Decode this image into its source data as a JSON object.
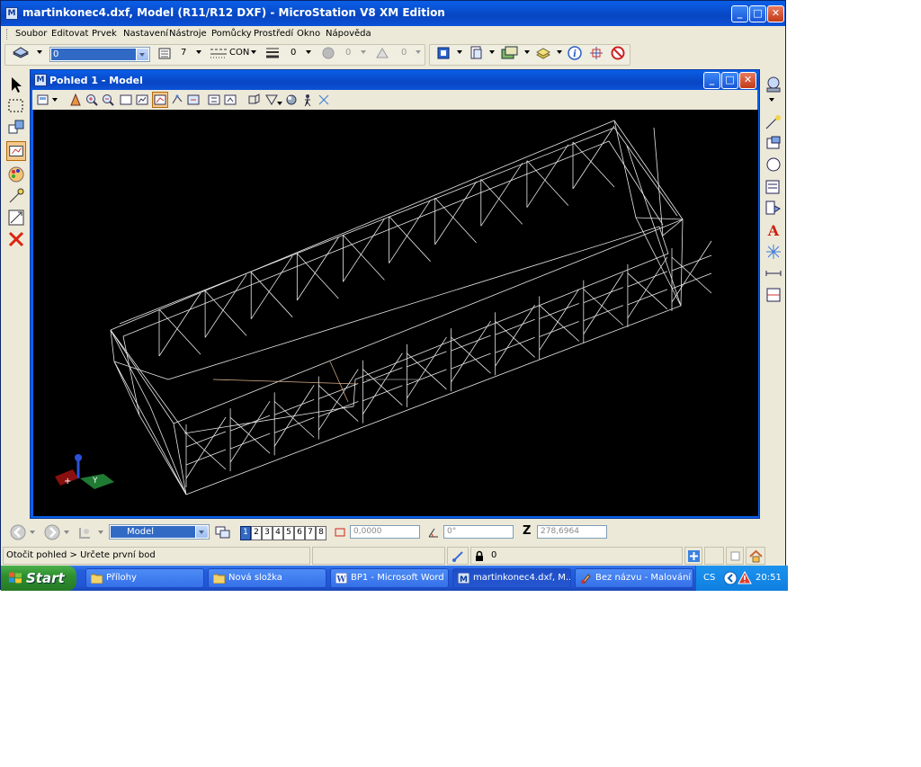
{
  "window": {
    "title": "martinkonec4.dxf, Model (R11/R12 DXF) - MicroStation V8 XM Edition",
    "app_icon": "microstation-icon"
  },
  "menu": [
    "Soubor",
    "Editovat",
    "Prvek",
    "Nastavení",
    "Nástroje",
    "Pomůcky",
    "Prostředí",
    "Okno",
    "Nápověda"
  ],
  "toolbar": {
    "level_value": "0",
    "color_value": "7",
    "style_value": "CON",
    "weight_value": "0",
    "transparency_value": "0",
    "priority_value": "0"
  },
  "view": {
    "title": "Pohled 1 - Model",
    "background_color": "#000000",
    "wire_color": "#e8e8e8"
  },
  "bottom": {
    "model_value": "Model",
    "view_numbers": [
      "1",
      "2",
      "3",
      "4",
      "5",
      "6",
      "7",
      "8"
    ],
    "active_view": "1",
    "field_x": "0,0000",
    "field_angle": "0°",
    "z_label": "Z",
    "field_z": "278,6964"
  },
  "status": {
    "prompt": "Otočit pohled > Určete první bod",
    "lock_count": "0"
  },
  "taskbar": {
    "start_label": "Start",
    "tasks": [
      {
        "label": "Přílohy",
        "icon": "folder-icon"
      },
      {
        "label": "Nová složka",
        "icon": "folder-icon"
      },
      {
        "label": "BP1 - Microsoft Word",
        "icon": "word-icon"
      },
      {
        "label": "martinkonec4.dxf, M...",
        "icon": "microstation-icon"
      },
      {
        "label": "Bez názvu - Malování",
        "icon": "paint-icon"
      }
    ],
    "language": "CS",
    "clock": "20:51"
  }
}
